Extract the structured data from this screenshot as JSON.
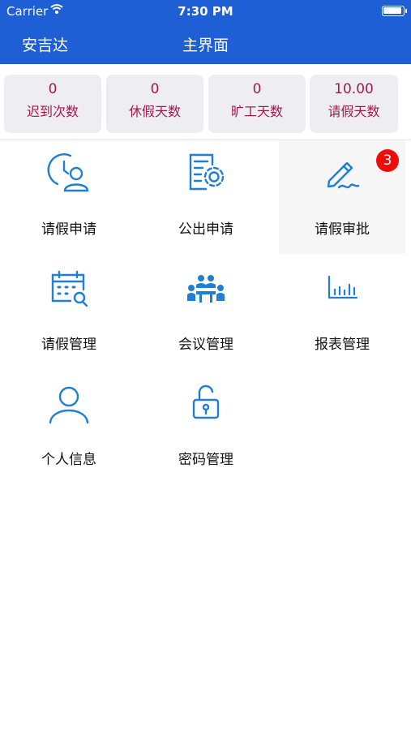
{
  "status_bar": {
    "carrier": "Carrier",
    "time": "7:30 PM"
  },
  "nav": {
    "left": "安吉达",
    "title": "主界面"
  },
  "stats": [
    {
      "value": "0",
      "label": "迟到次数"
    },
    {
      "value": "0",
      "label": "休假天数"
    },
    {
      "value": "0",
      "label": "旷工天数"
    },
    {
      "value": "10.00",
      "label": "请假天数"
    }
  ],
  "menu": [
    {
      "label": "请假申请",
      "icon": "clock-person-icon"
    },
    {
      "label": "公出申请",
      "icon": "document-gear-icon"
    },
    {
      "label": "请假审批",
      "icon": "pen-sign-icon",
      "badge": "3"
    },
    {
      "label": "请假管理",
      "icon": "calendar-search-icon"
    },
    {
      "label": "会议管理",
      "icon": "meeting-icon"
    },
    {
      "label": "报表管理",
      "icon": "bar-chart-icon"
    },
    {
      "label": "个人信息",
      "icon": "user-icon"
    },
    {
      "label": "密码管理",
      "icon": "lock-icon"
    }
  ],
  "colors": {
    "nav_bg": "#1f5fd6",
    "stat_text": "#a4194b",
    "icon": "#1e7fd4",
    "badge": "#ee0c0c"
  }
}
